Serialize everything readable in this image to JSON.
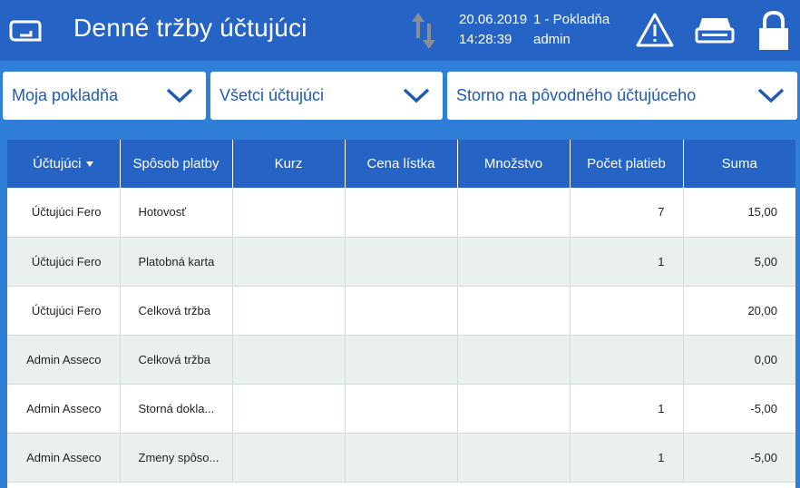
{
  "header": {
    "title": "Denné tržby účtujúci",
    "date": "20.06.2019",
    "time": "14:28:39",
    "register": "1 - Pokladňa",
    "user": "admin",
    "icons": [
      "app-logo-icon",
      "sync-arrows-icon",
      "warning-icon",
      "printer-icon",
      "lock-icon"
    ]
  },
  "filters": {
    "register_select": "Moja pokladňa",
    "cashier_select": "Všetci účtujúci",
    "storno_select": "Storno na pôvodného účtujúceho"
  },
  "table": {
    "columns": [
      "Účtujúci",
      "Spôsob platby",
      "Kurz",
      "Cena lístka",
      "Množstvo",
      "Počet platieb",
      "Suma"
    ],
    "rows": [
      {
        "cashier": "Účtujúci Fero",
        "payment": "Hotovosť",
        "rate": "",
        "ticket_price": "",
        "quantity": "",
        "count": "7",
        "sum": "15,00"
      },
      {
        "cashier": "Účtujúci Fero",
        "payment": "Platobná karta",
        "rate": "",
        "ticket_price": "",
        "quantity": "",
        "count": "1",
        "sum": "5,00"
      },
      {
        "cashier": "Účtujúci Fero",
        "payment": "Celková tržba",
        "rate": "",
        "ticket_price": "",
        "quantity": "",
        "count": "",
        "sum": "20,00"
      },
      {
        "cashier": "Admin Asseco",
        "payment": "Celková tržba",
        "rate": "",
        "ticket_price": "",
        "quantity": "",
        "count": "",
        "sum": "0,00"
      },
      {
        "cashier": "Admin Asseco",
        "payment": "Storná dokla...",
        "rate": "",
        "ticket_price": "",
        "quantity": "",
        "count": "1",
        "sum": "-5,00"
      },
      {
        "cashier": "Admin Asseco",
        "payment": "Zmeny spôso...",
        "rate": "",
        "ticket_price": "",
        "quantity": "",
        "count": "1",
        "sum": "-5,00"
      }
    ]
  },
  "colors": {
    "header_bg": "#2563c4",
    "page_bg": "#2f7fd8",
    "accent_text": "#1f5bb5",
    "row_alt": "#e9f0ed"
  }
}
